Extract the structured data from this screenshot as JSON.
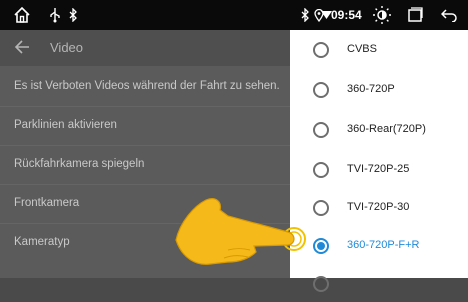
{
  "statusbar": {
    "time": "09:54",
    "icons": [
      "home-icon",
      "usb-icon",
      "bluetooth-icon",
      "location-icon",
      "wifi-icon",
      "brightness-icon",
      "recent-apps-icon",
      "back-icon"
    ]
  },
  "screen": {
    "title": "Video",
    "back_icon": "back-arrow-icon",
    "settings": [
      {
        "label": "Es ist Verboten Videos während der Fahrt zu sehen."
      },
      {
        "label": "Parklinien aktivieren"
      },
      {
        "label": "Rückfahrkamera spiegeln"
      },
      {
        "label": "Frontkamera"
      },
      {
        "label": "Kameratyp"
      }
    ]
  },
  "camera_type_menu": {
    "options": [
      {
        "label": "CVBS",
        "selected": false
      },
      {
        "label": "360-720P",
        "selected": false
      },
      {
        "label": "360-Rear(720P)",
        "selected": false
      },
      {
        "label": "TVI-720P-25",
        "selected": false
      },
      {
        "label": "TVI-720P-30",
        "selected": false
      },
      {
        "label": "360-720P-F+R",
        "selected": true
      }
    ],
    "accent_color": "#1f8ad8"
  },
  "overlay": {
    "icon": "pointing-hand-icon"
  }
}
